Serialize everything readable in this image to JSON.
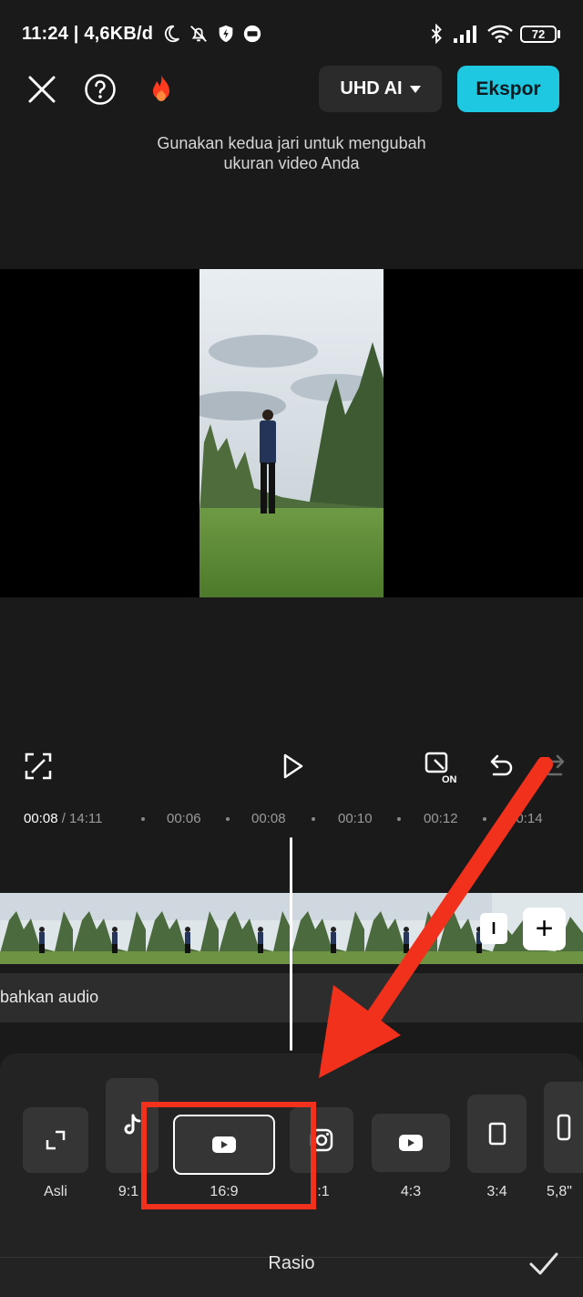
{
  "status_bar": {
    "time": "11:24 | 4,6KB/d",
    "battery": "72"
  },
  "toolbar": {
    "resolution_label": "UHD AI",
    "export_label": "Ekspor"
  },
  "hint_line1": "Gunakan kedua jari untuk mengubah",
  "hint_line2": "ukuran video Anda",
  "timeline": {
    "current": "00:08",
    "total": "/ 14:11",
    "ticks": [
      "00:06",
      "00:08",
      "00:10",
      "00:12",
      "00:14"
    ],
    "audio_label": "bahkan audio"
  },
  "ratio_panel": {
    "title": "Rasio",
    "options": [
      "Asli",
      "9:1",
      "16:9",
      ":1",
      "4:3",
      "3:4",
      "5,8\""
    ],
    "selected": "16:9"
  },
  "colors": {
    "accent": "#1ec8e0",
    "annotation": "#f2311c",
    "background": "#1a1a1a"
  }
}
